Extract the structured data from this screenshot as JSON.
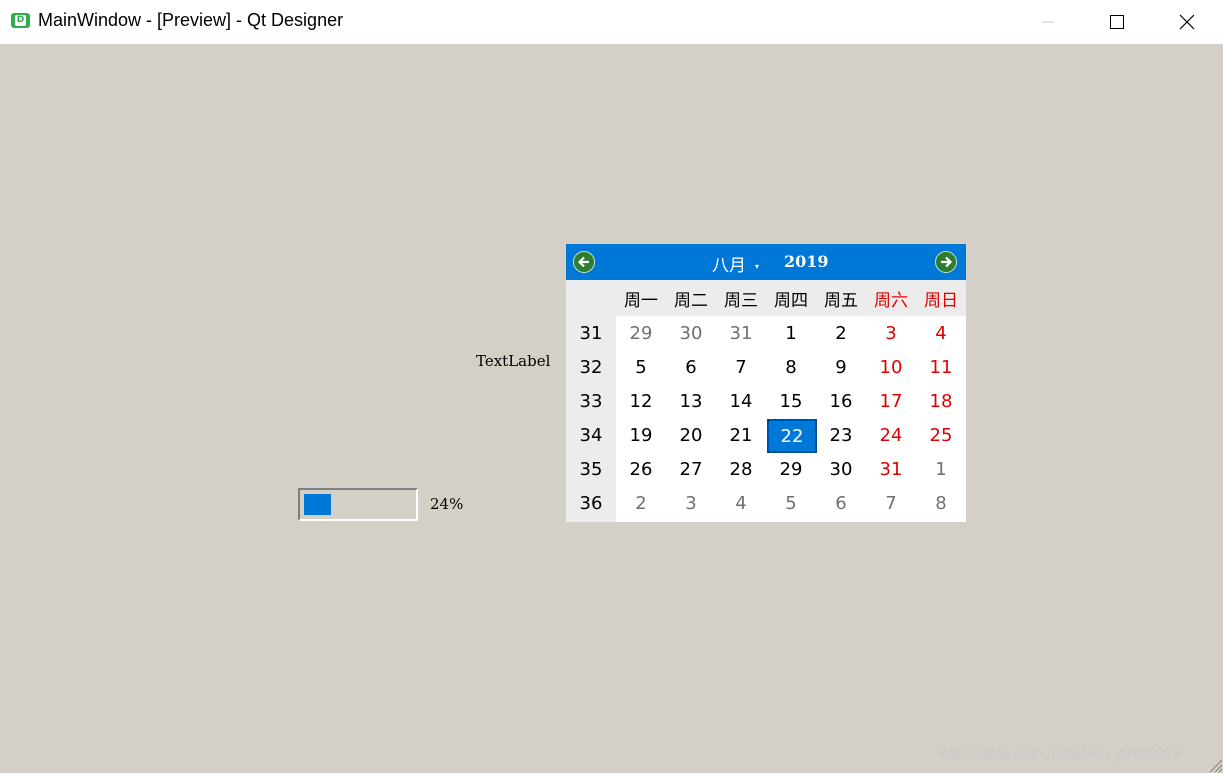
{
  "window": {
    "icon_text": "D",
    "title": "MainWindow - [Preview] - Qt Designer"
  },
  "widgets": {
    "text_label": "TextLabel",
    "progress": {
      "value": 24,
      "text": "24%"
    }
  },
  "calendar": {
    "month": "八月",
    "year": "2019",
    "day_names": [
      "周一",
      "周二",
      "周三",
      "周四",
      "周五",
      "周六",
      "周日"
    ],
    "weeks": [
      {
        "week": "31",
        "days": [
          "29",
          "30",
          "31",
          "1",
          "2",
          "3",
          "4"
        ]
      },
      {
        "week": "32",
        "days": [
          "5",
          "6",
          "7",
          "8",
          "9",
          "10",
          "11"
        ]
      },
      {
        "week": "33",
        "days": [
          "12",
          "13",
          "14",
          "15",
          "16",
          "17",
          "18"
        ]
      },
      {
        "week": "34",
        "days": [
          "19",
          "20",
          "21",
          "22",
          "23",
          "24",
          "25"
        ]
      },
      {
        "week": "35",
        "days": [
          "26",
          "27",
          "28",
          "29",
          "30",
          "31",
          "1"
        ]
      },
      {
        "week": "36",
        "days": [
          "2",
          "3",
          "4",
          "5",
          "6",
          "7",
          "8"
        ]
      }
    ],
    "selected_day": "22",
    "colors": {
      "header": "#0078d7",
      "weekend": "#e00000",
      "other_month": "#707070"
    }
  },
  "watermark": "https://blog.csdn.net/weixin_41999203"
}
